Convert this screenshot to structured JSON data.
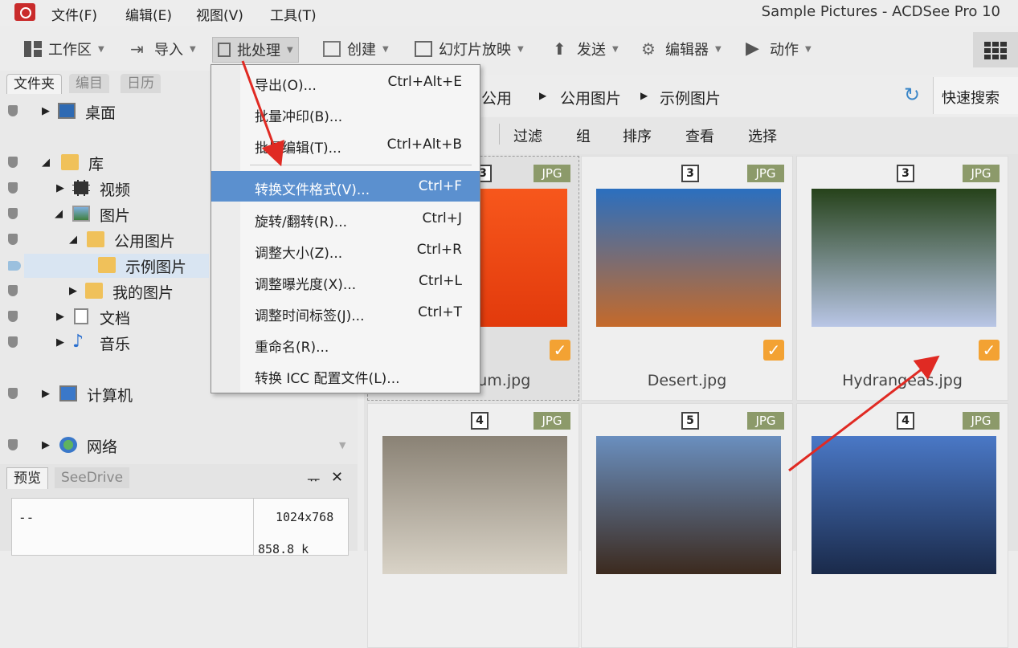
{
  "menubar": {
    "items": [
      "文件(F)",
      "编辑(E)",
      "视图(V)",
      "工具(T)"
    ],
    "title": "Sample Pictures - ACDSee Pro 10"
  },
  "toolbar": {
    "buttons": [
      "工作区",
      "导入",
      "批处理",
      "创建",
      "幻灯片放映",
      "发送",
      "编辑器",
      "动作"
    ]
  },
  "left": {
    "tabs": [
      "文件夹",
      "编目",
      "日历"
    ],
    "tree": [
      "桌面",
      "库",
      "视频",
      "图片",
      "公用图片",
      "示例图片",
      "我的图片",
      "文档",
      "音乐",
      "计算机",
      "网络"
    ]
  },
  "preview": {
    "tabs": [
      "预览",
      "SeeDrive"
    ],
    "pin": "ᅲ",
    "close": "✕",
    "dash": "--",
    "dims": "1024x768",
    "size": "858.8 k"
  },
  "breadcrumb": {
    "items": [
      "公用",
      "公用图片",
      "示例图片"
    ],
    "search_label": "快速搜索"
  },
  "filterbar": {
    "items": [
      "过滤",
      "组",
      "排序",
      "查看",
      "选择"
    ]
  },
  "thumbs": [
    {
      "rating": "3",
      "format": "JPG",
      "name": "mum.jpg",
      "checked": true,
      "colors": [
        "#f7571c",
        "#e23a0c"
      ]
    },
    {
      "rating": "3",
      "format": "JPG",
      "name": "Desert.jpg",
      "checked": true,
      "colors": [
        "#2b6fbf",
        "#c56a2a"
      ]
    },
    {
      "rating": "3",
      "format": "JPG",
      "name": "Hydrangeas.jpg",
      "checked": true,
      "colors": [
        "#26421a",
        "#b9c6e6"
      ]
    },
    {
      "rating": "4",
      "format": "JPG",
      "name": "",
      "checked": false,
      "colors": [
        "#8a8275",
        "#d9d3c7"
      ]
    },
    {
      "rating": "5",
      "format": "JPG",
      "name": "",
      "checked": false,
      "colors": [
        "#6a8fbf",
        "#3c2a1e"
      ]
    },
    {
      "rating": "4",
      "format": "JPG",
      "name": "",
      "checked": false,
      "colors": [
        "#4a78c6",
        "#1a2a4a"
      ]
    }
  ],
  "dropdown": {
    "items": [
      {
        "label": "导出(O)...",
        "shortcut": "Ctrl+Alt+E"
      },
      {
        "label": "批量冲印(B)...",
        "shortcut": ""
      },
      {
        "label": "批量编辑(T)...",
        "shortcut": "Ctrl+Alt+B"
      },
      {
        "label": "转换文件格式(V)...",
        "shortcut": "Ctrl+F"
      },
      {
        "label": "旋转/翻转(R)...",
        "shortcut": "Ctrl+J"
      },
      {
        "label": "调整大小(Z)...",
        "shortcut": "Ctrl+R"
      },
      {
        "label": "调整曝光度(X)...",
        "shortcut": "Ctrl+L"
      },
      {
        "label": "调整时间标签(J)...",
        "shortcut": "Ctrl+T"
      },
      {
        "label": "重命名(R)...",
        "shortcut": ""
      },
      {
        "label": "转换 ICC 配置文件(L)...",
        "shortcut": ""
      }
    ]
  },
  "colors": {
    "accent": "#5b90cf",
    "annotation": "#e02a23",
    "check": "#f3a233"
  }
}
